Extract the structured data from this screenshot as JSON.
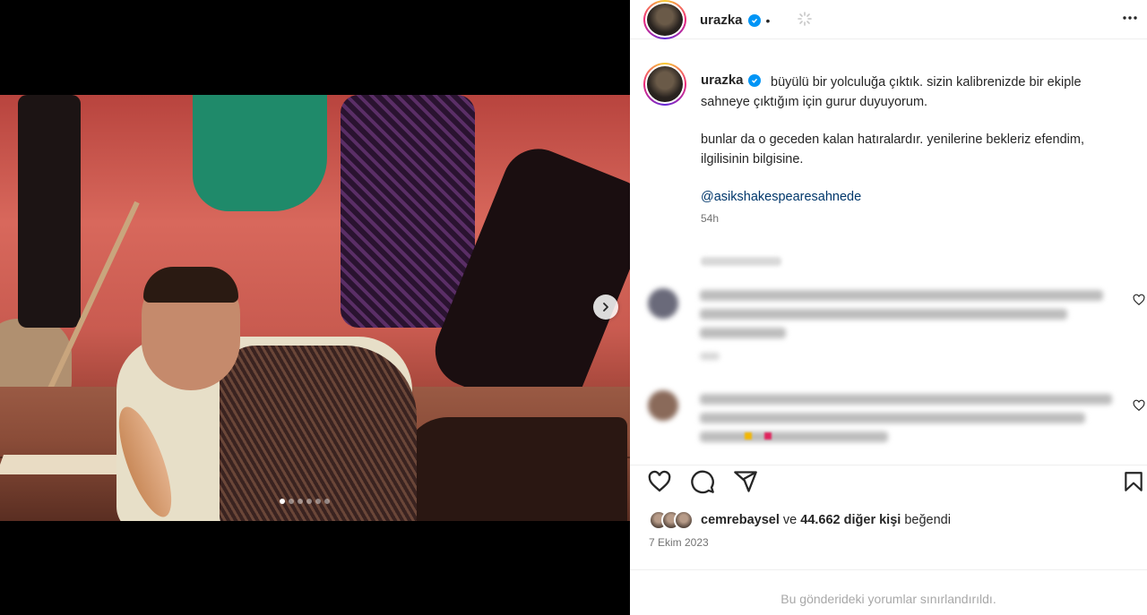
{
  "post": {
    "username": "urazka",
    "separator": "•",
    "caption_paragraph_1": "büyülü bir yolculuğa çıktık. sizin kalibrenizde bir ekiple sahneye çıktığım için gurur duyuyorum.",
    "caption_paragraph_2": "bunlar da o geceden kalan hatıralardır. yenilerine bekleriz efendim, ilgilisinin bilgisine.",
    "mention": "@asikshakespearesahnede",
    "time_ago": "54h",
    "liked_by_user": "cemrebaysel",
    "liked_by_connector": "ve",
    "liked_by_count": "44.662 diğer kişi",
    "liked_by_suffix": "beğendi",
    "date": "7 Ekim 2023",
    "comments_restricted": "Bu gönderideki yorumlar sınırlandırıldı."
  },
  "carousel": {
    "total_slides": 6,
    "active_slide": 1
  },
  "icons": {
    "verified": "verified-badge-icon",
    "more": "more-options-icon",
    "like": "heart-icon",
    "comment": "comment-icon",
    "share": "share-icon",
    "save": "bookmark-icon",
    "next": "chevron-right-icon"
  },
  "colors": {
    "verified": "#0095f6",
    "mention": "#00376b",
    "muted": "#737373"
  }
}
